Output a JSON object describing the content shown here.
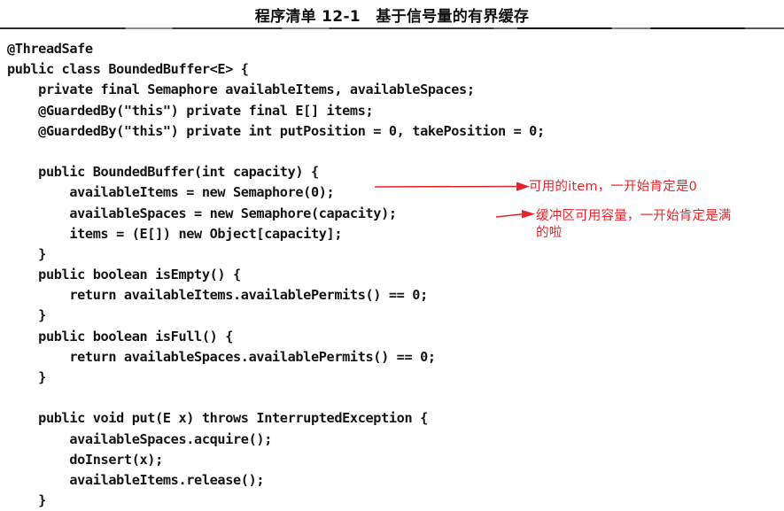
{
  "page": {
    "title": "程序清单 12-1　基于信号量的有界缓存",
    "background_color": "#ffffff",
    "text_color": "#141414",
    "annotation_color": "#e8242a"
  },
  "code": {
    "language": "java",
    "lines": [
      "@ThreadSafe",
      "public class BoundedBuffer<E> {",
      "    private final Semaphore availableItems, availableSpaces;",
      "    @GuardedBy(\"this\") private final E[] items;",
      "    @GuardedBy(\"this\") private int putPosition = 0, takePosition = 0;",
      "",
      "    public BoundedBuffer(int capacity) {",
      "        availableItems = new Semaphore(0);",
      "        availableSpaces = new Semaphore(capacity);",
      "        items = (E[]) new Object[capacity];",
      "    }",
      "    public boolean isEmpty() {",
      "        return availableItems.availablePermits() == 0;",
      "    }",
      "    public boolean isFull() {",
      "        return availableSpaces.availablePermits() == 0;",
      "    }",
      "",
      "    public void put(E x) throws InterruptedException {",
      "        availableSpaces.acquire();",
      "        doInsert(x);",
      "        availableItems.release();",
      "    }"
    ]
  },
  "annotations": [
    {
      "id": "annotation-available-items",
      "text": "可用的item，一开始肯定是0",
      "points_to_code_line": "        availableItems = new Semaphore(0);",
      "arrow": "arrow-right"
    },
    {
      "id": "annotation-available-spaces",
      "text": "缓冲区可用容量，一开始肯定是满\n的啦",
      "points_to_code_line": "        availableSpaces = new Semaphore(capacity);",
      "arrow": "arrow-right"
    }
  ]
}
